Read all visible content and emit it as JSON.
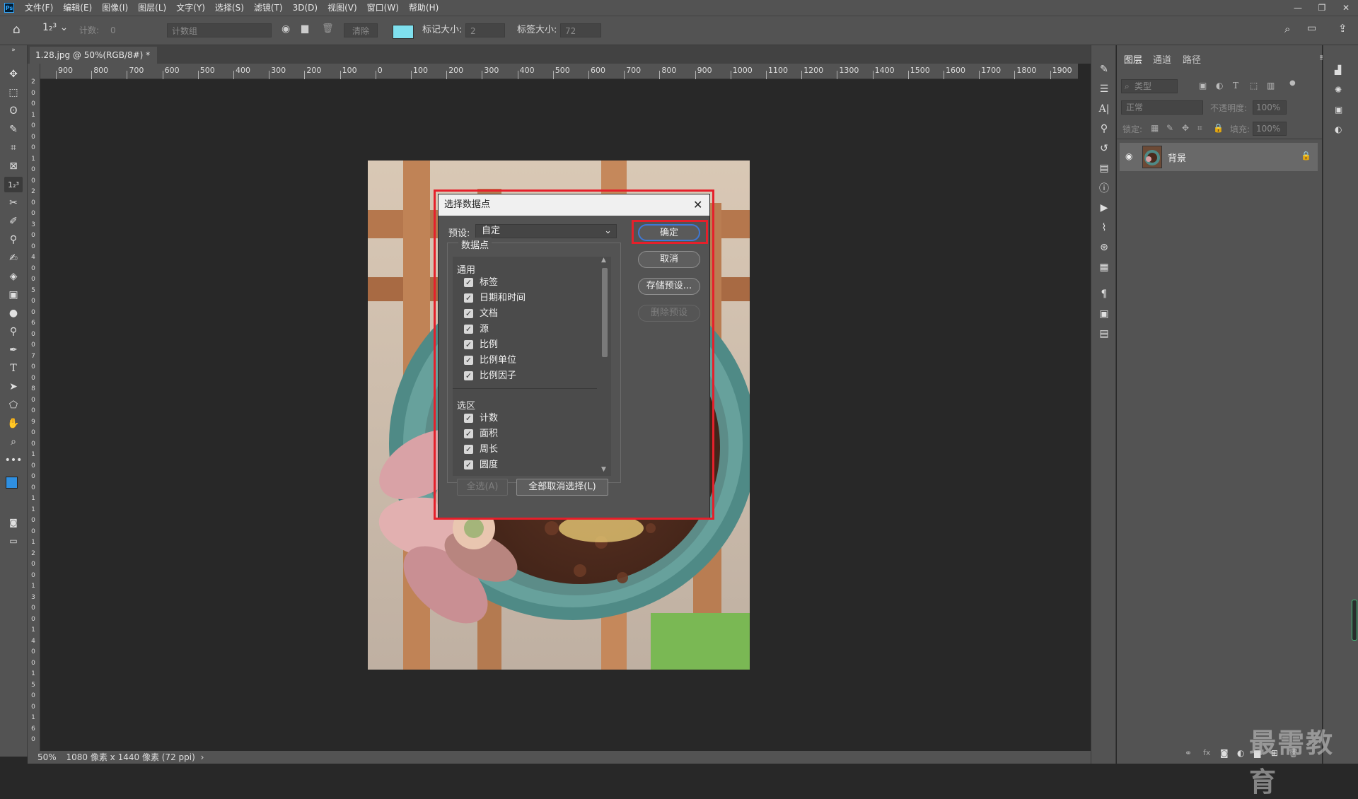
{
  "menubar": {
    "logo": "Ps",
    "items": [
      "文件(F)",
      "编辑(E)",
      "图像(I)",
      "图层(L)",
      "文字(Y)",
      "选择(S)",
      "滤镜(T)",
      "3D(D)",
      "视图(V)",
      "窗口(W)",
      "帮助(H)"
    ]
  },
  "optionsbar": {
    "tool_label": "1₂³",
    "count_label": "计数:",
    "count_value": "0",
    "count_group": "计数组",
    "clear_label": "清除",
    "marker_size_label": "标记大小:",
    "marker_size_value": "2",
    "label_size_label": "标签大小:",
    "label_size_value": "72",
    "swatch_color": "#7fe0ee"
  },
  "document": {
    "tab_title": "1.28.jpg @ 50%(RGB/8#) *",
    "zoom": "50%",
    "status": "1080 像素 x 1440 像素 (72 ppi)"
  },
  "ruler": {
    "h_labels": [
      "900",
      "800",
      "700",
      "600",
      "500",
      "400",
      "300",
      "200",
      "100",
      "0",
      "100",
      "200",
      "300",
      "400",
      "500",
      "600",
      "700",
      "800",
      "900",
      "1000",
      "1100",
      "1200",
      "1300",
      "1400",
      "1500",
      "1600",
      "1700",
      "1800",
      "1900"
    ],
    "v_labels": [
      "2",
      "0",
      "0",
      "1",
      "0",
      "0",
      "0",
      "1",
      "0",
      "0",
      "2",
      "0",
      "0",
      "3",
      "0",
      "0",
      "4",
      "0",
      "0",
      "5",
      "0",
      "0",
      "6",
      "0",
      "0",
      "7",
      "0",
      "0",
      "8",
      "0",
      "0",
      "9",
      "0",
      "0",
      "1",
      "0",
      "0",
      "0",
      "1",
      "1",
      "0",
      "0",
      "1",
      "2",
      "0",
      "0",
      "1",
      "3",
      "0",
      "0",
      "1",
      "4",
      "0",
      "0",
      "1",
      "5",
      "0",
      "0",
      "1",
      "6",
      "0",
      "0"
    ]
  },
  "dialog": {
    "title": "选择数据点",
    "preset_label": "预设:",
    "preset_value": "自定",
    "group_label": "数据点",
    "section_general": "通用",
    "general_items": [
      "标签",
      "日期和时间",
      "文档",
      "源",
      "比例",
      "比例单位",
      "比例因子"
    ],
    "section_selection": "选区",
    "selection_items": [
      "计数",
      "面积",
      "周长",
      "圆度"
    ],
    "select_all": "全选(A)",
    "deselect_all": "全部取消选择(L)",
    "ok": "确定",
    "cancel": "取消",
    "save_preset": "存储预设...",
    "delete_preset": "删除预设"
  },
  "layers_panel": {
    "tabs": [
      "图层",
      "通道",
      "路径"
    ],
    "filter_kind": "类型",
    "blend_mode": "正常",
    "opacity_label": "不透明度:",
    "opacity_value": "100%",
    "lock_label": "锁定:",
    "fill_label": "填充:",
    "fill_value": "100%",
    "layer_name": "背景"
  },
  "watermark": "最需教育",
  "colors": {
    "foreground": "#2f8fe0",
    "background": "#ffffff",
    "highlight": "#e5202b"
  }
}
